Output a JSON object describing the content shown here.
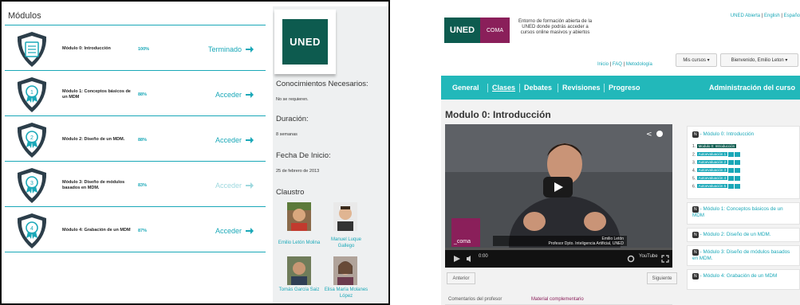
{
  "left": {
    "modules_title": "Módulos",
    "modules": [
      {
        "num": "",
        "title": "Módulo 0: Introducción",
        "pct": "100%",
        "action": "Terminado"
      },
      {
        "num": "1",
        "title": "Módulo 1: Conceptos básicos de un MDM",
        "pct": "88%",
        "action": "Acceder"
      },
      {
        "num": "2",
        "title": "Módulo 2: Diseño de un MDM.",
        "pct": "88%",
        "action": "Acceder"
      },
      {
        "num": "3",
        "title": "Módulo 3: Diseño de módulos basados en MDM.",
        "pct": "83%",
        "action": "Acceder"
      },
      {
        "num": "4",
        "title": "Módulo 4: Grabación de un MDM",
        "pct": "87%",
        "action": "Acceder"
      }
    ],
    "logo_text": "UNED",
    "conocimientos_head": "Conocimientos Necesarios:",
    "conocimientos_val": "No se requieren.",
    "duracion_head": "Duración:",
    "duracion_val": "8 semanas",
    "fecha_head": "Fecha De Inicio:",
    "fecha_val": "25 de febrero de 2013",
    "claustro_head": "Claustro",
    "people": [
      {
        "name": "Emilio Letón Molina"
      },
      {
        "name": "Manuel Luque Gallego"
      },
      {
        "name": "Tomás García Saiz"
      },
      {
        "name": "Elisa María Molanes López"
      }
    ],
    "colors": {
      "accent": "#1aa8b8",
      "badge_dark": "#2c3e4a"
    }
  },
  "right": {
    "logo_uned": "UNED",
    "logo_coma": "COMA",
    "tagline": "Entorno de formación abierta de la UNED donde podrás acceder a cursos online masivos y abiertos",
    "top_links": {
      "a": "UNED Abierta",
      "b": "English",
      "c": "Españo"
    },
    "nav_links": {
      "inicio": "Inicio",
      "faq": "FAQ",
      "metodologia": "Metodología"
    },
    "mis_cursos": "Mis cursos ▾",
    "bienvenido": "Bienvenido, Emilio Leton ▾",
    "tabs": [
      "General",
      "Clases",
      "Debates",
      "Revisiones",
      "Progreso"
    ],
    "admin_tab": "Administración del curso",
    "page_title": "Modulo 0: Introducción",
    "video": {
      "name": "Emilio Letón",
      "role": "Profesor Dpto. Inteligencia Artificial, UNED",
      "time": "0:00",
      "coma_label": "_coma",
      "youtube": "YouTube"
    },
    "anterior": "Anterior",
    "siguiente": "Siguiente",
    "bottom_tabs": [
      "Comentarios del profesor",
      "Material complementario"
    ],
    "outline": {
      "m0": "- Módulo 0: Introducción",
      "subitems": [
        {
          "n": "1.",
          "label": "Modulo 0: Introducción"
        },
        {
          "n": "2.",
          "label": "Autoevaluación 1"
        },
        {
          "n": "3.",
          "label": "Autoevaluación 2"
        },
        {
          "n": "4.",
          "label": "Autoevaluación 3"
        },
        {
          "n": "5.",
          "label": "Autoevaluación 4"
        },
        {
          "n": "6.",
          "label": "Autoevaluación 5"
        }
      ],
      "m1": "- Módulo 1: Conceptos básicos de un MDM",
      "m2": "- Módulo 2: Diseño de un MDM.",
      "m3": "- Módulo 3: Diseño de módulos basados en MDM.",
      "m4": "- Módulo 4: Grabación de un MDM"
    },
    "colors": {
      "teal": "#22b8ba",
      "uned_green": "#0d5b4f",
      "coma_purple": "#8a1f5a"
    }
  }
}
